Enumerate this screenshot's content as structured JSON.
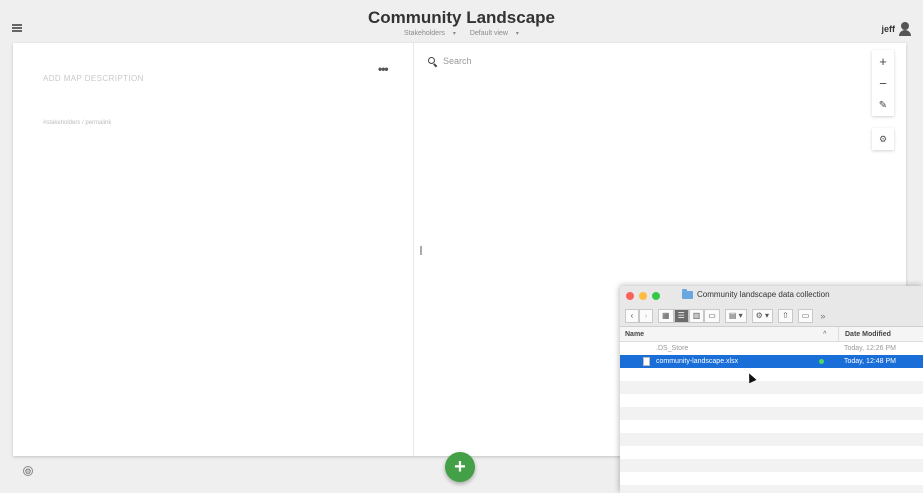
{
  "header": {
    "title": "Community Landscape",
    "map_selector": "Stakeholders",
    "view_selector": "Default view"
  },
  "user": {
    "name": "jeff"
  },
  "left_panel": {
    "description_placeholder": "ADD MAP DESCRIPTION",
    "more_label": "•••",
    "permalink": "#stakeholders / permalink"
  },
  "right_panel": {
    "search_placeholder": "Search",
    "zoom_in": "+",
    "zoom_out": "−",
    "draw": "✎",
    "settings": "⚙"
  },
  "fab_label": "+",
  "finder": {
    "title": "Community landscape data collection",
    "columns": {
      "name": "Name",
      "sort_indicator": "^",
      "date": "Date Modified"
    },
    "files": [
      {
        "name": ".DS_Store",
        "date": "Today, 12:26 PM",
        "selected": false
      },
      {
        "name": "community-landscape.xlsx",
        "date": "Today, 12:48 PM",
        "selected": true
      }
    ],
    "icons": {
      "back": "back-arrow-icon",
      "forward": "forward-arrow-icon",
      "more": "chevron-double-right-icon"
    },
    "colors": {
      "close": "#fc605b",
      "minimize": "#fdbc40",
      "zoom": "#34c84a",
      "selection": "#1a6ed8"
    }
  }
}
